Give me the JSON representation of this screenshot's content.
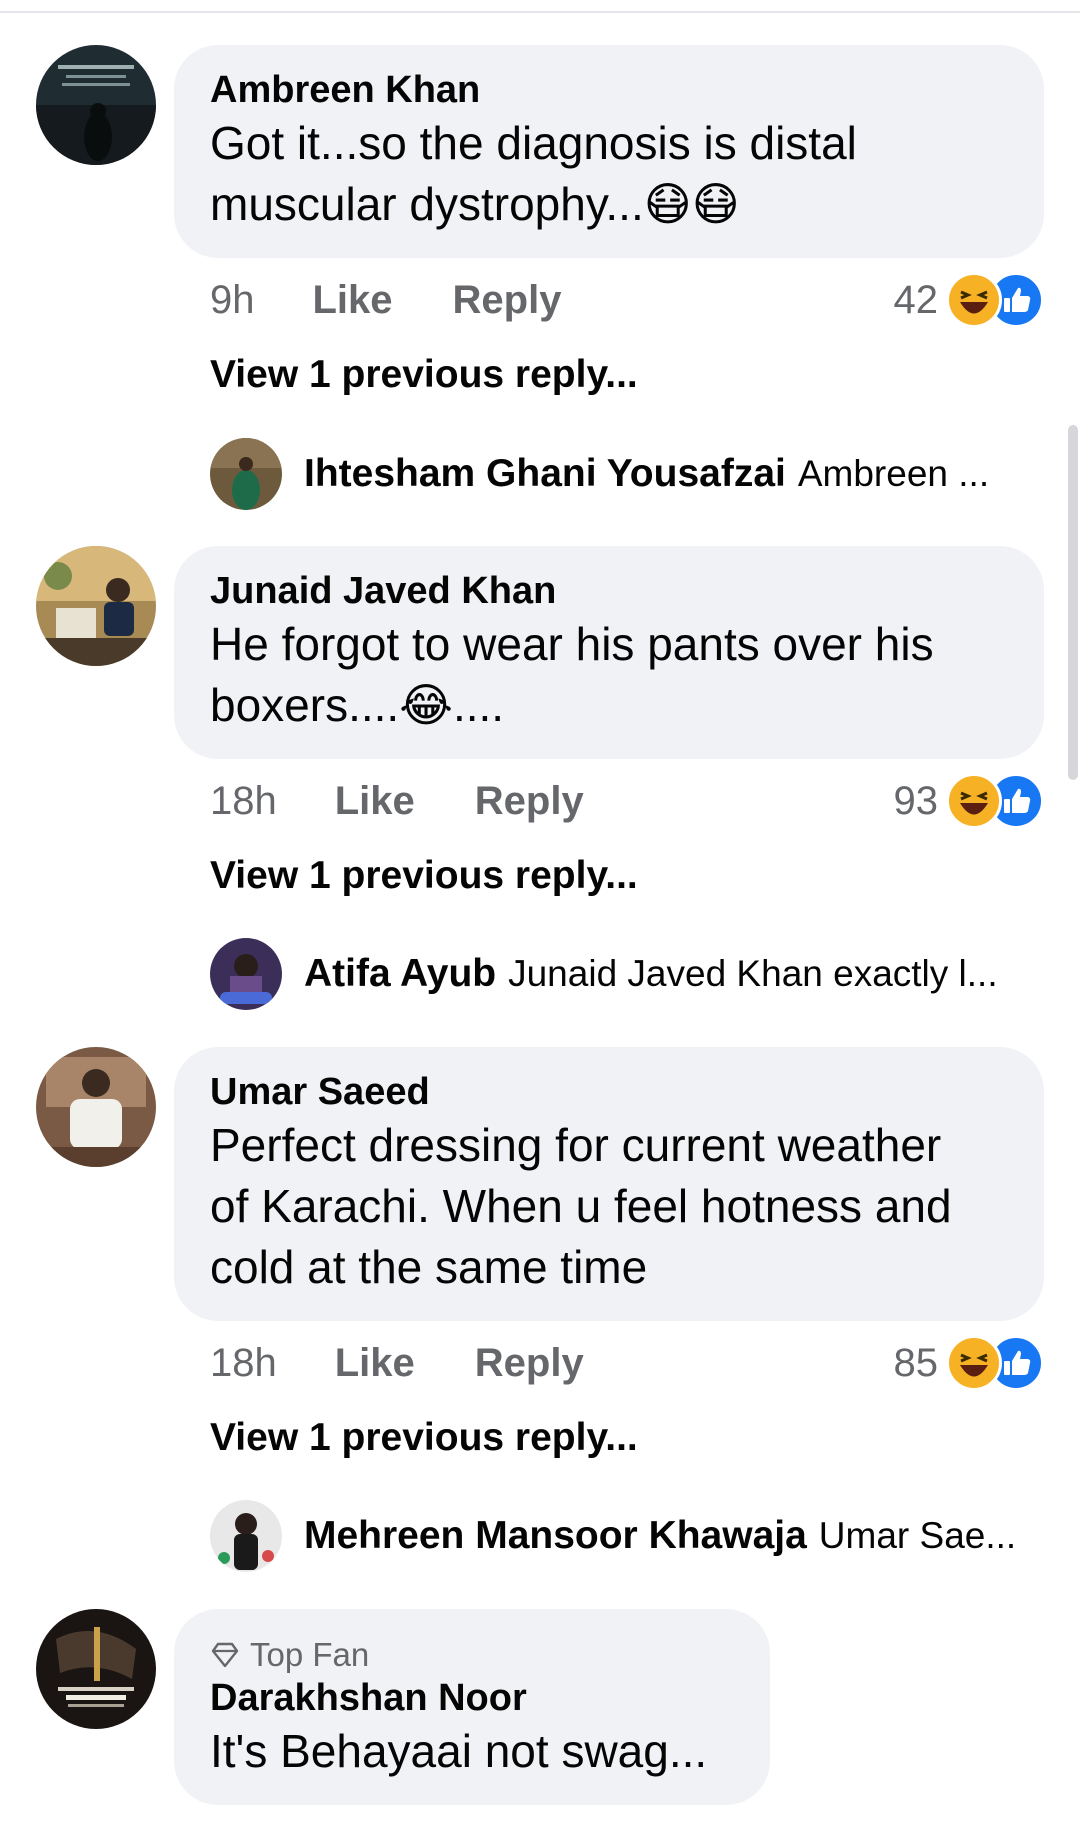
{
  "comments": [
    {
      "author": "Ambreen Khan",
      "text_lines": [
        "Got it...so the diagnosis is distal",
        "muscular dystrophy...😷😷"
      ],
      "time": "9h",
      "like_label": "Like",
      "reply_label": "Reply",
      "reaction_count": "42",
      "view_previous": "View 1 previous reply...",
      "reply_preview": {
        "name": "Ihtesham Ghani Yousafzai",
        "text": "Ambreen ..."
      }
    },
    {
      "author": "Junaid Javed Khan",
      "text_lines": [
        "He forgot to wear his pants over his",
        "boxers....😂...."
      ],
      "time": "18h",
      "like_label": "Like",
      "reply_label": "Reply",
      "reaction_count": "93",
      "view_previous": "View 1 previous reply...",
      "reply_preview": {
        "name": "Atifa Ayub",
        "text": "Junaid Javed Khan exactly l..."
      }
    },
    {
      "author": "Umar Saeed",
      "text_lines": [
        "Perfect dressing for current weather",
        "of Karachi. When u feel hotness and",
        "cold at the same time"
      ],
      "time": "18h",
      "like_label": "Like",
      "reply_label": "Reply",
      "reaction_count": "85",
      "view_previous": "View 1 previous reply...",
      "reply_preview": {
        "name": "Mehreen Mansoor Khawaja",
        "text": "Umar Sae..."
      }
    },
    {
      "badge": "Top Fan",
      "author": "Darakhshan Noor",
      "text_lines": [
        "It's Behayaai not swag..."
      ]
    }
  ],
  "reaction_icons": [
    "haha-icon",
    "like-icon"
  ],
  "colors": {
    "bubble": "#f0f2f5",
    "meta_text": "#65676b",
    "like_blue": "#1877f2",
    "haha_yellow": "#f7b125"
  }
}
